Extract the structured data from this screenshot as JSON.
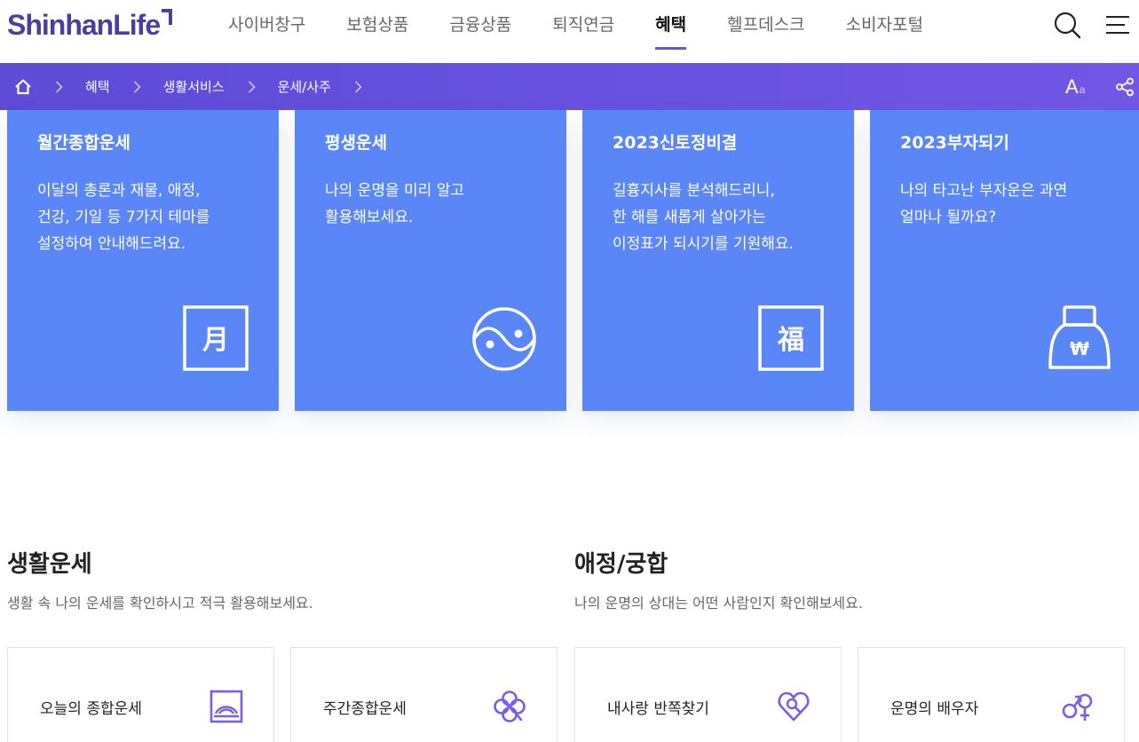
{
  "brand": {
    "logo": "ShinhanLife"
  },
  "gnb": [
    {
      "label": "사이버창구"
    },
    {
      "label": "보험상품"
    },
    {
      "label": "금융상품"
    },
    {
      "label": "퇴직연금"
    },
    {
      "label": "혜택",
      "active": true
    },
    {
      "label": "헬프데스크"
    },
    {
      "label": "소비자포털"
    }
  ],
  "header_icons": [
    "search-icon",
    "menu-icon"
  ],
  "breadcrumb": {
    "items": [
      "혜택",
      "생활서비스",
      "운세/사주"
    ]
  },
  "tools": {
    "font_main": "A",
    "font_sub": "a",
    "share_icon": "share-icon"
  },
  "cards": [
    {
      "title": "월간종합운세",
      "desc": [
        "이달의 총론과 재물, 애정,",
        "건강, 기일 등 7가지 테마를",
        "설정하여 안내해드려요."
      ],
      "icon": "month-icon",
      "glyph": "月"
    },
    {
      "title": "평생운세",
      "desc": [
        "나의 운명을 미리 알고",
        "활용해보세요."
      ],
      "icon": "yin-yang-icon"
    },
    {
      "title": "2023신토정비결",
      "desc": [
        "길흉지사를 분석해드리니,",
        "한 해를 새롭게 살아가는",
        "이정표가 되시기를 기원해요."
      ],
      "icon": "fortune-icon",
      "glyph": "福"
    },
    {
      "title": "2023부자되기",
      "desc": [
        "나의 타고난 부자운은 과연",
        "얼마나 될까요?"
      ],
      "icon": "money-bag-icon",
      "glyph": "₩"
    }
  ],
  "sections": [
    {
      "title": "생활운세",
      "desc": "생활 속 나의 운세를 확인하시고 적극 활용해보세요."
    },
    {
      "title": "애정/궁합",
      "desc": "나의 운명의 상대는 어떤 사람인지 확인해보세요."
    }
  ],
  "services": [
    {
      "label": "오늘의 종합운세",
      "icon": "sunrise-icon"
    },
    {
      "label": "주간종합운세",
      "icon": "clover-icon"
    },
    {
      "label": "내사랑 반쪽찾기",
      "icon": "heart-search-icon"
    },
    {
      "label": "운명의 배우자",
      "icon": "gender-icon"
    }
  ],
  "colors": {
    "accent": "#6c4ee8",
    "bar": "#6651df",
    "card": "#5b86f7",
    "icon_purple": "#7b5ce8",
    "logo": "#4a3f9f"
  }
}
